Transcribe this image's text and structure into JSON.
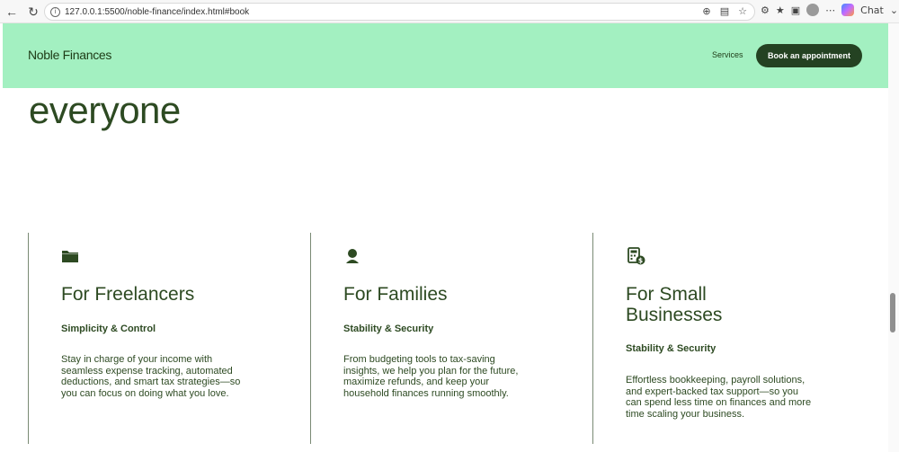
{
  "browser": {
    "url": "127.0.0.1:5500/noble-finance/index.html#book",
    "chat_label": "Chat"
  },
  "header": {
    "brand": "Noble Finances",
    "nav_services": "Services",
    "book_button": "Book an appointment"
  },
  "hero": {
    "word": "everyone"
  },
  "cards": [
    {
      "icon": "folder-icon",
      "title": "For Freelancers",
      "subtitle": "Simplicity & Control",
      "body": "Stay in charge of your income with seamless expense tracking, automated deductions, and smart tax strategies—so you can focus on doing what you love."
    },
    {
      "icon": "person-icon",
      "title": "For Families",
      "subtitle": "Stability & Security",
      "body": "From budgeting tools to tax-saving insights, we help you plan for the future, maximize refunds, and keep your household finances running smoothly."
    },
    {
      "icon": "calculator-dollar-icon",
      "title": "For Small Businesses",
      "subtitle": "Stability & Security",
      "body": "Effortless bookkeeping, payroll solutions, and expert-backed tax support—so you can spend less time on finances and more time scaling your business."
    }
  ]
}
